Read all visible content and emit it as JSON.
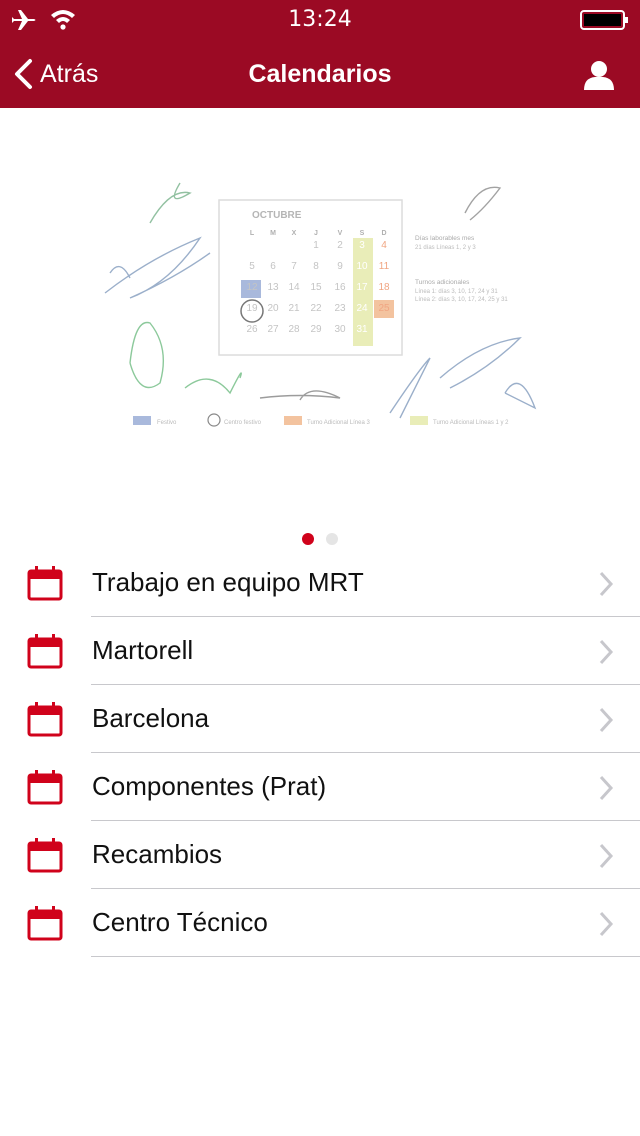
{
  "status_bar": {
    "time": "13:24"
  },
  "nav": {
    "back_label": "Atrás",
    "title": "Calendarios"
  },
  "colors": {
    "brand": "#9b0a24",
    "accent": "#d0021b",
    "dot_inactive": "#e5e5e5"
  },
  "hero": {
    "month": "OCTUBRE",
    "weekdays": [
      "L",
      "M",
      "X",
      "J",
      "V",
      "S",
      "D"
    ],
    "weeks": [
      [
        "",
        "",
        "",
        "1",
        "2",
        "3",
        "4"
      ],
      [
        "5",
        "6",
        "7",
        "8",
        "9",
        "10",
        "11"
      ],
      [
        "12",
        "13",
        "14",
        "15",
        "16",
        "17",
        "18"
      ],
      [
        "19",
        "20",
        "21",
        "22",
        "23",
        "24",
        "25"
      ],
      [
        "26",
        "27",
        "28",
        "29",
        "30",
        "31",
        ""
      ]
    ],
    "side_title": "Días laborables mes",
    "side_line": "21 días Líneas 1, 2 y 3",
    "side_title2": "Turnos adicionales",
    "side_line2": "Línea 1: días 3, 10, 17, 24 y 31",
    "side_line3": "Línea 2: días 3, 10, 17, 24, 25 y 31",
    "legend": [
      "Festivo",
      "Centro festivo",
      "Turno Adicional Línea 3",
      "Turno Adicional Líneas 1 y 2"
    ]
  },
  "pager": {
    "count": 2,
    "active": 0
  },
  "list": {
    "items": [
      {
        "label": "Trabajo en equipo MRT",
        "icon": "calendar-icon"
      },
      {
        "label": "Martorell",
        "icon": "calendar-icon"
      },
      {
        "label": "Barcelona",
        "icon": "calendar-icon"
      },
      {
        "label": "Componentes (Prat)",
        "icon": "calendar-icon"
      },
      {
        "label": "Recambios",
        "icon": "calendar-icon"
      },
      {
        "label": "Centro Técnico",
        "icon": "calendar-icon"
      }
    ]
  }
}
